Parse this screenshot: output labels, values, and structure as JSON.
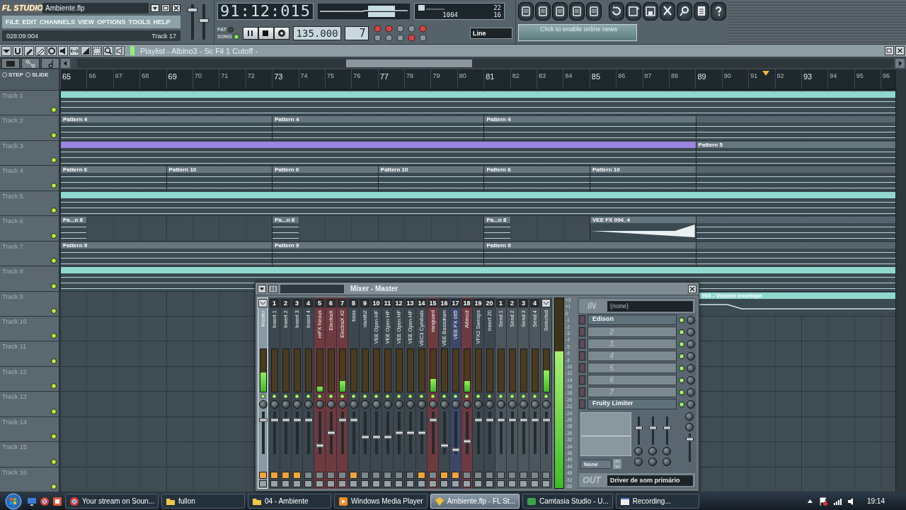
{
  "toolbar": {
    "logo": "FL STUDIO",
    "file": "Ambiente.flp",
    "menu": [
      "FILE",
      "EDIT",
      "CHANNELS",
      "VIEW",
      "OPTIONS",
      "TOOLS",
      "HELP"
    ],
    "hint": {
      "position": "028:09:004",
      "target": "Track 17"
    },
    "master_volume": {
      "level": 0.85
    },
    "master_pitch": {
      "level": 0.55
    },
    "time": "91:12:015",
    "cpu": "22",
    "memory": "1004",
    "polyphony": "16",
    "modes": [
      {
        "label": "PAT",
        "selected": false
      },
      {
        "label": "SONG",
        "selected": true
      }
    ],
    "tempo": "135.000",
    "pattern": "7",
    "snap": "Line",
    "news": "Click to enable online news"
  },
  "playlist": {
    "title": "Playlist - Albino3 - Sc Fil 1 Cutoff -",
    "toggles": [
      "STEP",
      "SLIDE"
    ],
    "ruler": [
      "65",
      "66",
      "67",
      "68",
      "69",
      "70",
      "71",
      "72",
      "73",
      "74",
      "75",
      "76",
      "77",
      "78",
      "79",
      "80",
      "81",
      "82",
      "83",
      "84",
      "85",
      "86",
      "87",
      "88",
      "89",
      "90",
      "91",
      "92",
      "93",
      "94",
      "95",
      "96"
    ],
    "playhead": {
      "level": 0.845
    },
    "tracks": [
      {
        "name": "Track 1",
        "on": true,
        "clips": [
          {
            "kind": "pattern",
            "color": "#8fd8cf"
          }
        ]
      },
      {
        "name": "Track 2",
        "on": true,
        "clips": [
          {
            "kind": "pattern",
            "color": "#66767e",
            "label": "Pattern 4"
          },
          {
            "kind": "pattern",
            "color": "#66767e",
            "label": "Pattern 4"
          },
          {
            "kind": "pattern",
            "color": "#66767e",
            "label": "Pattern 4"
          },
          {
            "kind": "pattern",
            "color": "#56656d"
          }
        ]
      },
      {
        "name": "Track 3",
        "on": true,
        "clips": [
          {
            "kind": "pattern",
            "color": "#9a86e0"
          },
          {
            "kind": "pattern",
            "color": "#66767e",
            "label": "Pattern 5"
          }
        ]
      },
      {
        "name": "Track 4",
        "on": true,
        "clips": [
          {
            "kind": "pattern",
            "color": "#66767e",
            "label": "Pattern 6"
          },
          {
            "kind": "pattern",
            "color": "#66767e",
            "label": "Pattern 10"
          },
          {
            "kind": "pattern",
            "color": "#66767e",
            "label": "Pattern 6"
          },
          {
            "kind": "pattern",
            "color": "#66767e",
            "label": "Pattern 10"
          },
          {
            "kind": "pattern",
            "color": "#66767e",
            "label": "Pattern 6"
          },
          {
            "kind": "pattern",
            "color": "#66767e",
            "label": "Pattern 10"
          },
          {
            "kind": "pattern",
            "color": "#56656d"
          }
        ]
      },
      {
        "name": "Track 5",
        "on": true,
        "clips": [
          {
            "kind": "pattern",
            "color": "#8fd8cf"
          }
        ]
      },
      {
        "name": "Track 6",
        "on": true,
        "clips": [
          {
            "kind": "pattern",
            "color": "#66767e",
            "label": "Pa...n 8"
          },
          {
            "kind": "pattern",
            "color": "#66767e",
            "label": "Pa...n 8"
          },
          {
            "kind": "pattern",
            "color": "#66767e",
            "label": "Pa...n 8"
          },
          {
            "kind": "audio",
            "color": "#66767e",
            "label": "VEE FX 094_4"
          },
          {
            "kind": "pattern",
            "color": "#56656d"
          }
        ]
      },
      {
        "name": "Track 7",
        "on": true,
        "clips": [
          {
            "kind": "pattern",
            "color": "#66767e",
            "label": "Pattern 9"
          },
          {
            "kind": "pattern",
            "color": "#66767e",
            "label": "Pattern 9"
          },
          {
            "kind": "pattern",
            "color": "#66767e",
            "label": "Pattern 9"
          },
          {
            "kind": "pattern",
            "color": "#56656d"
          }
        ]
      },
      {
        "name": "Track 8",
        "on": true,
        "clips": [
          {
            "kind": "pattern",
            "color": "#8fd8cf"
          }
        ]
      },
      {
        "name": "Track 9",
        "on": true,
        "clips": [
          {
            "kind": "automation",
            "color": "#8fd8cf",
            "label": "003 - Volume envelope"
          }
        ]
      },
      {
        "name": "Track 10",
        "on": true
      },
      {
        "name": "Track 11",
        "on": true
      },
      {
        "name": "Track 12",
        "on": true
      },
      {
        "name": "Track 13",
        "on": true
      },
      {
        "name": "Track 14",
        "on": true
      },
      {
        "name": "Track 15",
        "on": true
      },
      {
        "name": "Track 16",
        "on": true
      }
    ]
  },
  "mixer": {
    "title": "Mixer - Master",
    "strips": [
      {
        "name": "Master",
        "selected": true,
        "color": "#8a9aa4",
        "meter": {
          "level": 0.45
        },
        "fader": {
          "level": 0.8
        },
        "armed": true
      },
      {
        "name": "Insert 1",
        "number": "1",
        "selected": false,
        "color": "#3d474e",
        "meter": {
          "level": 0
        },
        "fader": {
          "level": 0.8
        },
        "armed": true
      },
      {
        "name": "Insert 2",
        "number": "2",
        "selected": false,
        "color": "#3d474e",
        "meter": {
          "level": 0
        },
        "fader": {
          "level": 0.8
        },
        "armed": true
      },
      {
        "name": "Insert 3",
        "number": "3",
        "selected": false,
        "color": "#3d474e",
        "meter": {
          "level": 0
        },
        "fader": {
          "level": 0.8
        },
        "armed": true
      },
      {
        "name": "Insert 4",
        "number": "4",
        "selected": false,
        "color": "#3d474e",
        "meter": {
          "level": 0
        },
        "fader": {
          "level": 0.8
        },
        "armed": false
      },
      {
        "name": "reFX Nexus",
        "number": "5",
        "selected": false,
        "color": "#6e3a40",
        "meter": {
          "level": 0.12
        },
        "fader": {
          "level": 0.2
        },
        "armed": false
      },
      {
        "name": "ElectraX",
        "number": "6",
        "selected": false,
        "color": "#6e3a40",
        "meter": {
          "level": 0
        },
        "fader": {
          "level": 0.5
        },
        "armed": false
      },
      {
        "name": "ElectraX #2",
        "number": "7",
        "selected": false,
        "color": "#6e3a40",
        "meter": {
          "level": 0.25
        },
        "fader": {
          "level": 0.8
        },
        "armed": false
      },
      {
        "name": "bass",
        "number": "8",
        "selected": false,
        "color": "#3d474e",
        "meter": {
          "level": 0
        },
        "fader": {
          "level": 0.8
        },
        "armed": true
      },
      {
        "name": "vlanth2",
        "number": "9",
        "selected": false,
        "color": "#3d474e",
        "meter": {
          "level": 0
        },
        "fader": {
          "level": 0.4
        },
        "armed": false
      },
      {
        "name": "VEE Open HF",
        "number": "10",
        "selected": false,
        "color": "#3d474e",
        "meter": {
          "level": 0
        },
        "fader": {
          "level": 0.4
        },
        "armed": false
      },
      {
        "name": "VEE Open HF",
        "number": "11",
        "selected": false,
        "color": "#3d474e",
        "meter": {
          "level": 0
        },
        "fader": {
          "level": 0.4
        },
        "armed": false
      },
      {
        "name": "VEE Open HF",
        "number": "12",
        "selected": false,
        "color": "#3d474e",
        "meter": {
          "level": 0
        },
        "fader": {
          "level": 0.5
        },
        "armed": false
      },
      {
        "name": "VEE Open HF",
        "number": "13",
        "selected": false,
        "color": "#3d474e",
        "meter": {
          "level": 0
        },
        "fader": {
          "level": 0.5
        },
        "armed": false
      },
      {
        "name": "VEC3 Cymbals",
        "number": "14",
        "selected": false,
        "color": "#3d474e",
        "meter": {
          "level": 0
        },
        "fader": {
          "level": 0.5
        },
        "armed": true
      },
      {
        "name": "vanguard",
        "number": "15",
        "selected": false,
        "color": "#6e3a40",
        "meter": {
          "level": 0.3
        },
        "fader": {
          "level": 0.8
        },
        "armed": false
      },
      {
        "name": "VEE Bassdrum",
        "number": "16",
        "selected": false,
        "color": "#3d474e",
        "meter": {
          "level": 0
        },
        "fader": {
          "level": 0.2
        },
        "armed": true
      },
      {
        "name": "VEE FX 065",
        "number": "17",
        "selected": false,
        "color": "#3e4668",
        "meter": {
          "level": 0
        },
        "fader": {
          "level": 0.1
        },
        "armed": true
      },
      {
        "name": "Albino3",
        "number": "18",
        "selected": false,
        "color": "#6e3a40",
        "meter": {
          "level": 0.25
        },
        "fader": {
          "level": 0.3
        },
        "armed": false
      },
      {
        "name": "VFX2 Sweeps",
        "number": "19",
        "selected": false,
        "color": "#3d474e",
        "meter": {
          "level": 0
        },
        "fader": {
          "level": 0.8
        },
        "armed": false
      },
      {
        "name": "Insert 20",
        "number": "20",
        "selected": false,
        "color": "#3d474e",
        "meter": {
          "level": 0
        },
        "fader": {
          "level": 0.8
        },
        "armed": false
      },
      {
        "name": "Send 1",
        "number": "1",
        "selected": false,
        "color": "#4c565c",
        "meter": {
          "level": 0
        },
        "fader": {
          "level": 0.8
        },
        "armed": false
      },
      {
        "name": "Send 2",
        "number": "2",
        "selected": false,
        "color": "#4c565c",
        "meter": {
          "level": 0
        },
        "fader": {
          "level": 0.8
        },
        "armed": false
      },
      {
        "name": "Send 3",
        "number": "3",
        "selected": false,
        "color": "#4c565c",
        "meter": {
          "level": 0
        },
        "fader": {
          "level": 0.8
        },
        "armed": false
      },
      {
        "name": "Send 4",
        "number": "4",
        "selected": false,
        "color": "#4c565c",
        "meter": {
          "level": 0
        },
        "fader": {
          "level": 0.8
        },
        "armed": false
      },
      {
        "name": "Selected",
        "selected": false,
        "color": "#4c565c",
        "meter": {
          "level": 0.5
        },
        "fader": {
          "level": 0.8
        },
        "armed": false
      }
    ],
    "master_meter": {
      "level": 0.72
    },
    "scale": [
      "+3",
      "+1",
      "0",
      "-1",
      "-2",
      "-3",
      "-4",
      "-5",
      "-6",
      "-8",
      "-10",
      "-12",
      "-14",
      "-16",
      "-18",
      "-20",
      "-22",
      "-24",
      "-26",
      "-28",
      "-30",
      "-32",
      "-34",
      "-36",
      "-40",
      "-44",
      "-48",
      "-52",
      "-60"
    ],
    "input_label": "IN",
    "input": "(none)",
    "slots": [
      {
        "kind": "plugin",
        "name": "Edison",
        "on": true
      },
      {
        "kind": "empty",
        "name": "2",
        "on": true
      },
      {
        "kind": "empty",
        "name": "3",
        "on": true
      },
      {
        "kind": "empty",
        "name": "4",
        "on": true
      },
      {
        "kind": "empty",
        "name": "5",
        "on": true
      },
      {
        "kind": "empty",
        "name": "6",
        "on": true
      },
      {
        "kind": "empty",
        "name": "7",
        "on": true
      },
      {
        "kind": "plugin",
        "name": "Fruity Limiter",
        "on": true
      }
    ],
    "limiter_sliders": [
      {
        "level": 0.6
      },
      {
        "level": 0.6
      },
      {
        "level": 0.6
      }
    ],
    "volume": {
      "level": 0.8
    },
    "eq_preset": "None",
    "output_label": "OUT",
    "output": "Driver de som primário"
  },
  "taskbar": {
    "tasks": [
      {
        "kind": "browser",
        "label": "Your stream on Soun...",
        "selected": false
      },
      {
        "kind": "folder",
        "label": "fullon",
        "selected": false
      },
      {
        "kind": "folder",
        "label": "04 - Ambiente",
        "selected": false
      },
      {
        "kind": "player",
        "label": "Windows Media Player",
        "selected": false
      },
      {
        "kind": "daw",
        "label": "Ambiente.flp - FL St...",
        "selected": true
      },
      {
        "kind": "recorder",
        "label": "Camtasia Studio - U...",
        "selected": false
      },
      {
        "kind": "window",
        "label": "Recording...",
        "selected": false
      }
    ],
    "clock": "19:14"
  }
}
